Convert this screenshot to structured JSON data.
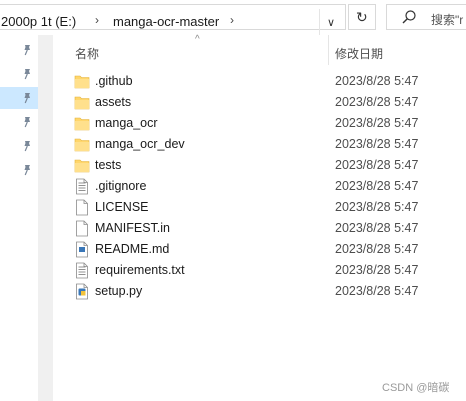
{
  "address": {
    "crumbs": [
      "2000p 1t (E:)",
      "manga-ocr-master"
    ],
    "separator": "›",
    "dropdown": "∨",
    "refresh": "↻"
  },
  "search": {
    "placeholder": "搜索\"r"
  },
  "nav": {
    "item_count": 6,
    "selected_index": 2
  },
  "columns": {
    "name": "名称",
    "date": "修改日期",
    "sort_indicator": "^"
  },
  "files": [
    {
      "name": ".github",
      "date": "2023/8/28 5:47",
      "type": "folder"
    },
    {
      "name": "assets",
      "date": "2023/8/28 5:47",
      "type": "folder"
    },
    {
      "name": "manga_ocr",
      "date": "2023/8/28 5:47",
      "type": "folder"
    },
    {
      "name": "manga_ocr_dev",
      "date": "2023/8/28 5:47",
      "type": "folder"
    },
    {
      "name": "tests",
      "date": "2023/8/28 5:47",
      "type": "folder"
    },
    {
      "name": ".gitignore",
      "date": "2023/8/28 5:47",
      "type": "text"
    },
    {
      "name": "LICENSE",
      "date": "2023/8/28 5:47",
      "type": "file"
    },
    {
      "name": "MANIFEST.in",
      "date": "2023/8/28 5:47",
      "type": "file"
    },
    {
      "name": "README.md",
      "date": "2023/8/28 5:47",
      "type": "md"
    },
    {
      "name": "requirements.txt",
      "date": "2023/8/28 5:47",
      "type": "text"
    },
    {
      "name": "setup.py",
      "date": "2023/8/28 5:47",
      "type": "python"
    }
  ],
  "watermark": "CSDN @暗碳",
  "colors": {
    "folder": "#ffd66b",
    "selection": "#cce8ff",
    "python": "#3a77b8"
  }
}
